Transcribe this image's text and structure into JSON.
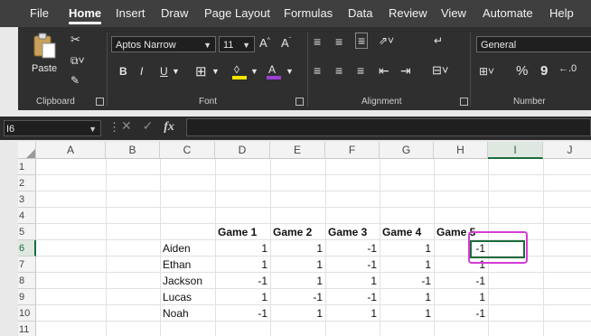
{
  "menu": {
    "tabs": [
      "File",
      "Home",
      "Insert",
      "Draw",
      "Page Layout",
      "Formulas",
      "Data",
      "Review",
      "View",
      "Automate",
      "Help"
    ],
    "active_tab": "Home"
  },
  "ribbon": {
    "clipboard": {
      "paste_label": "Paste",
      "group_label": "Clipboard"
    },
    "font": {
      "font_name": "Aptos Narrow",
      "font_size": "11",
      "bold": "B",
      "italic": "I",
      "underline": "U",
      "grow": "A^",
      "shrink": "Aˇ",
      "group_label": "Font"
    },
    "alignment": {
      "group_label": "Alignment"
    },
    "number": {
      "format": "General",
      "percent": "%",
      "comma": "9",
      "group_label": "Number"
    }
  },
  "formula_bar": {
    "name_box": "I6",
    "fx": "fx",
    "formula": ""
  },
  "sheet": {
    "columns": [
      "A",
      "B",
      "C",
      "D",
      "E",
      "F",
      "G",
      "H",
      "I",
      "J"
    ],
    "rows": [
      "1",
      "2",
      "3",
      "4",
      "5",
      "6",
      "7",
      "8",
      "9",
      "10",
      "11"
    ],
    "selected_column": "I",
    "selected_row": "6",
    "headers": [
      "Game 1",
      "Game 2",
      "Game 3",
      "Game 4",
      "Game 5"
    ],
    "players": [
      {
        "name": "Aiden",
        "scores": [
          "1",
          "1",
          "-1",
          "1",
          "-1"
        ]
      },
      {
        "name": "Ethan",
        "scores": [
          "1",
          "1",
          "-1",
          "1",
          "1"
        ]
      },
      {
        "name": "Jackson",
        "scores": [
          "-1",
          "1",
          "1",
          "-1",
          "-1"
        ]
      },
      {
        "name": "Lucas",
        "scores": [
          "1",
          "-1",
          "-1",
          "1",
          "1"
        ]
      },
      {
        "name": "Noah",
        "scores": [
          "-1",
          "1",
          "1",
          "1",
          "-1"
        ]
      }
    ]
  },
  "colors": {
    "accent": "#1e6b3c",
    "highlight": "#d63bd6",
    "ribbon": "#2f2f2f",
    "tabs": "#3f3f3f"
  }
}
